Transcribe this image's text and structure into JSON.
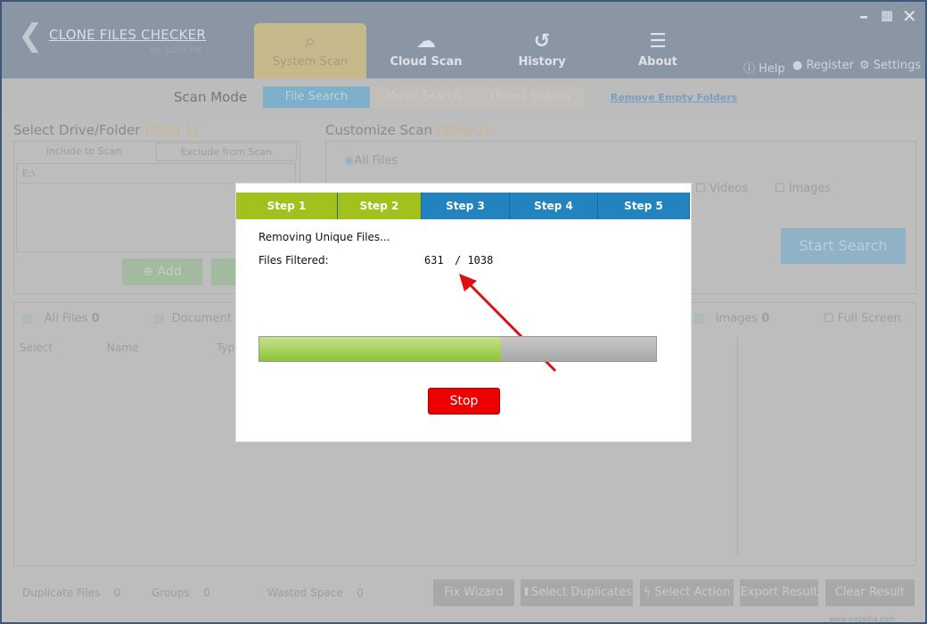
{
  "app": {
    "title": "CLONE FILES CHECKER",
    "subtitle": "by SORCIM"
  },
  "nav": [
    {
      "label": "System Scan",
      "icon": "monitor-search-icon",
      "active": true
    },
    {
      "label": "Cloud Scan",
      "icon": "cloud-search-icon"
    },
    {
      "label": "History",
      "icon": "history-icon"
    },
    {
      "label": "About",
      "icon": "about-icon"
    }
  ],
  "toplinks": {
    "help": "Help",
    "register": "Register",
    "settings": "Settings"
  },
  "scan_mode": {
    "label": "Scan Mode",
    "modes": [
      "File Search",
      "Music Search",
      "iTunes Search"
    ],
    "active": "File Search",
    "remove_empty": "Remove Empty Folders"
  },
  "select_drive": {
    "title": "Select Drive/Folder",
    "step": "(Step 1)",
    "tabs": [
      "Include to Scan",
      "Exclude from Scan"
    ],
    "paths": [
      "E:\\"
    ],
    "add_label": "Add"
  },
  "customize": {
    "title": "Customize Scan",
    "step": "(Step 2)",
    "all_files": "All Files",
    "videos": "Videos",
    "images": "Images",
    "start": "Start Search"
  },
  "results": {
    "tabs": [
      "All Files",
      "Document",
      "Images"
    ],
    "all_count": "0",
    "images_count": "0",
    "full_screen": "Full Screen",
    "columns": [
      "Select",
      "Name",
      "Typ"
    ]
  },
  "footer": {
    "duplicate_label": "Duplicate Files",
    "duplicate": "0",
    "groups_label": "Groups",
    "groups": "0",
    "wasted_label": "Wasted Space",
    "wasted": "0",
    "buttons": [
      "Fix Wizard",
      "Select Duplicates",
      "Select Action",
      "Export Result",
      "Clear Result"
    ]
  },
  "dialog": {
    "steps": [
      "Step 1",
      "Step 2",
      "Step 3",
      "Step 4",
      "Step 5"
    ],
    "completed_steps": 2,
    "status": "Removing Unique Files...",
    "filtered_label": "Files Filtered:",
    "filtered": "631",
    "total": "/ 1038",
    "progress_percent": 61,
    "stop": "Stop",
    "colors": {
      "done": "#a2c11c",
      "pending": "#2383be",
      "stop": "#ee0000"
    }
  },
  "watermark": "www.xiazaiba.com"
}
